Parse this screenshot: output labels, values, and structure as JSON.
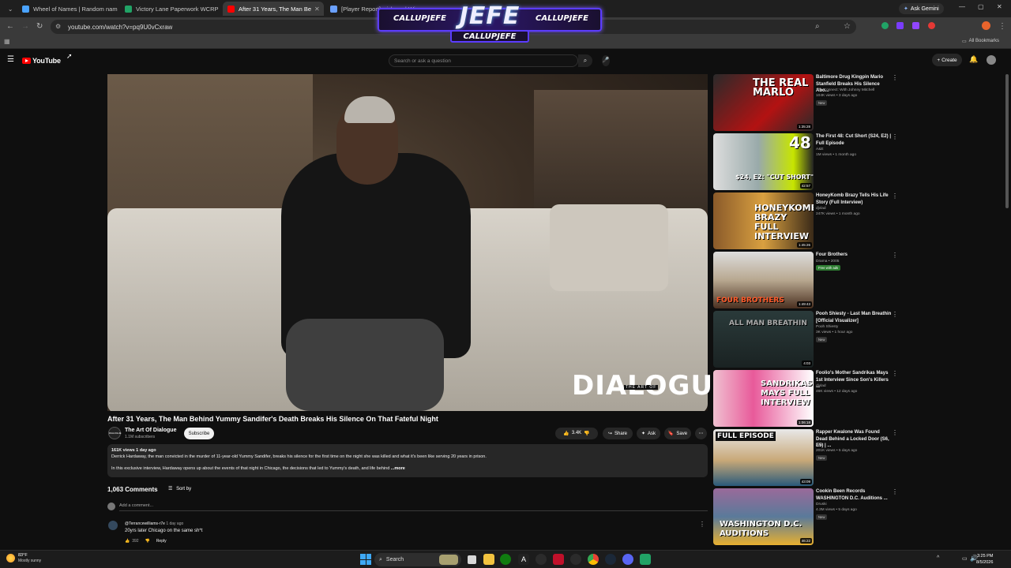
{
  "browser": {
    "tabs": [
      {
        "title": "Wheel of Names | Random nam",
        "icon": "wheel-icon",
        "color": "#4aa3ff",
        "active": false
      },
      {
        "title": "Victory Lane Paperwork WCRP",
        "icon": "sheets-icon",
        "color": "#21a366",
        "active": false
      },
      {
        "title": "After 31 Years, The Man Be",
        "icon": "youtube-icon",
        "color": "#ff0000",
        "active": true
      },
      {
        "title": "[Player Report] wickpov | Win",
        "icon": "forum-icon",
        "color": "#6aa0ff",
        "active": false
      }
    ],
    "url": "youtube.com/watch?v=pq9U0vCxraw",
    "ask_gemini": "Ask Gemini",
    "all_bookmarks": "All Bookmarks"
  },
  "overlay": {
    "logo": "JEFE",
    "handle_left": "CALLUPJEFE",
    "handle_right": "CALLUPJEFE",
    "handle_bottom": "CALLUPJEFE"
  },
  "youtube": {
    "logo_text": "YouTube",
    "search_placeholder": "Search or ask a question",
    "create_label": "Create"
  },
  "video": {
    "title": "After 31 Years, The Man Behind Yummy Sandifer's Death Breaks His Silence On That Fateful Night",
    "watermark": "DIALOGUE",
    "watermark_sub": "THE ART OF",
    "channel": {
      "name": "The Art Of Dialogue",
      "subscribers": "1.1M subscribers",
      "avatar_text": "DIALOGUE"
    },
    "subscribe_label": "Subscribe",
    "likes": "3.4K",
    "share_label": "Share",
    "ask_label": "Ask",
    "save_label": "Save",
    "description": {
      "meta": "161K views  1 day ago",
      "line1": "Derrick Hardaway, the man convicted in the murder of 11-year-old Yummy Sandifer, breaks his silence for the first time on the night she was killed and what it's been like serving 20 years in prison.",
      "line2": "In this exclusive interview, Hardaway opens up about the events of that night in Chicago, the decisions that led to Yummy's death, and life behind",
      "more": "...more"
    }
  },
  "comments": {
    "count_label": "1,063 Comments",
    "sort_label": "Sort by",
    "add_placeholder": "Add a comment...",
    "items": [
      {
        "user": "@Terrancewilliams-r7e",
        "time": "1 day ago",
        "text": "20yrs later Chicago on the same sh*t",
        "likes": "392",
        "reply": "Reply"
      }
    ]
  },
  "recommendations": [
    {
      "title": "Baltimore Drug Kingpin Mario Stanfield Breaks His Silence Abo...",
      "channel": "The Connect: With Johnny Mitchell",
      "views": "104K views • 3 days ago",
      "badge": "New",
      "duration": "1:35:28",
      "thumb_text": "THE REAL MARLO"
    },
    {
      "title": "The First 48: Cut Short (S24, E2) | Full Episode",
      "channel": "A&E",
      "views": "1M views • 1 month ago",
      "badge": "",
      "duration": "42:57",
      "thumb_text": "$24, E2: \"CUT SHORT\""
    },
    {
      "title": "HoneyKomb Brazy Tells His Life Story (Full Interview)",
      "channel": "djvlad",
      "views": "247K views • 1 month ago",
      "badge": "",
      "duration": "1:45:26",
      "thumb_text": "HONEYKOMB BRAZY FULL INTERVIEW"
    },
    {
      "title": "Four Brothers",
      "channel": "Drama • 2005",
      "views": "",
      "badge": "Free with ads",
      "duration": "1:49:43",
      "thumb_text": "FOUR BROTHERS"
    },
    {
      "title": "Pooh Shiesty - Last Man Breathin [Official Visualizer]",
      "channel": "Pooh Shiesty",
      "views": "3K views • 1 hour ago",
      "badge": "New",
      "duration": "4:03",
      "thumb_text": "ALL MAN BREATHIN"
    },
    {
      "title": "Foolio's Mother Sandrikas Mays 1st Interview Since Son's Killers ...",
      "channel": "djvlad",
      "views": "46K views • 12 days ago",
      "badge": "",
      "duration": "1:06:18",
      "thumb_text": "SANDRIKAS MAYS FULL INTERVIEW"
    },
    {
      "title": "Rapper Kwalone Was Found Dead Behind a Locked Door (S6, E5) | ...",
      "channel": "A&E",
      "views": "201K views • 5 days ago",
      "badge": "New",
      "duration": "43:09",
      "thumb_text": "FULL EPISODE"
    },
    {
      "title": "Cookin Been Records WASHINGTON D.C. Auditions ...",
      "channel": "Druski",
      "views": "4.3M views • 5 days ago",
      "badge": "New",
      "duration": "46:22",
      "thumb_text": "WASHINGTON D.C. AUDITIONS"
    }
  ],
  "taskbar": {
    "temp": "83°F",
    "weather": "Mostly sunny",
    "search": "Search",
    "time": "3:25 PM",
    "date": "8/5/2026"
  }
}
